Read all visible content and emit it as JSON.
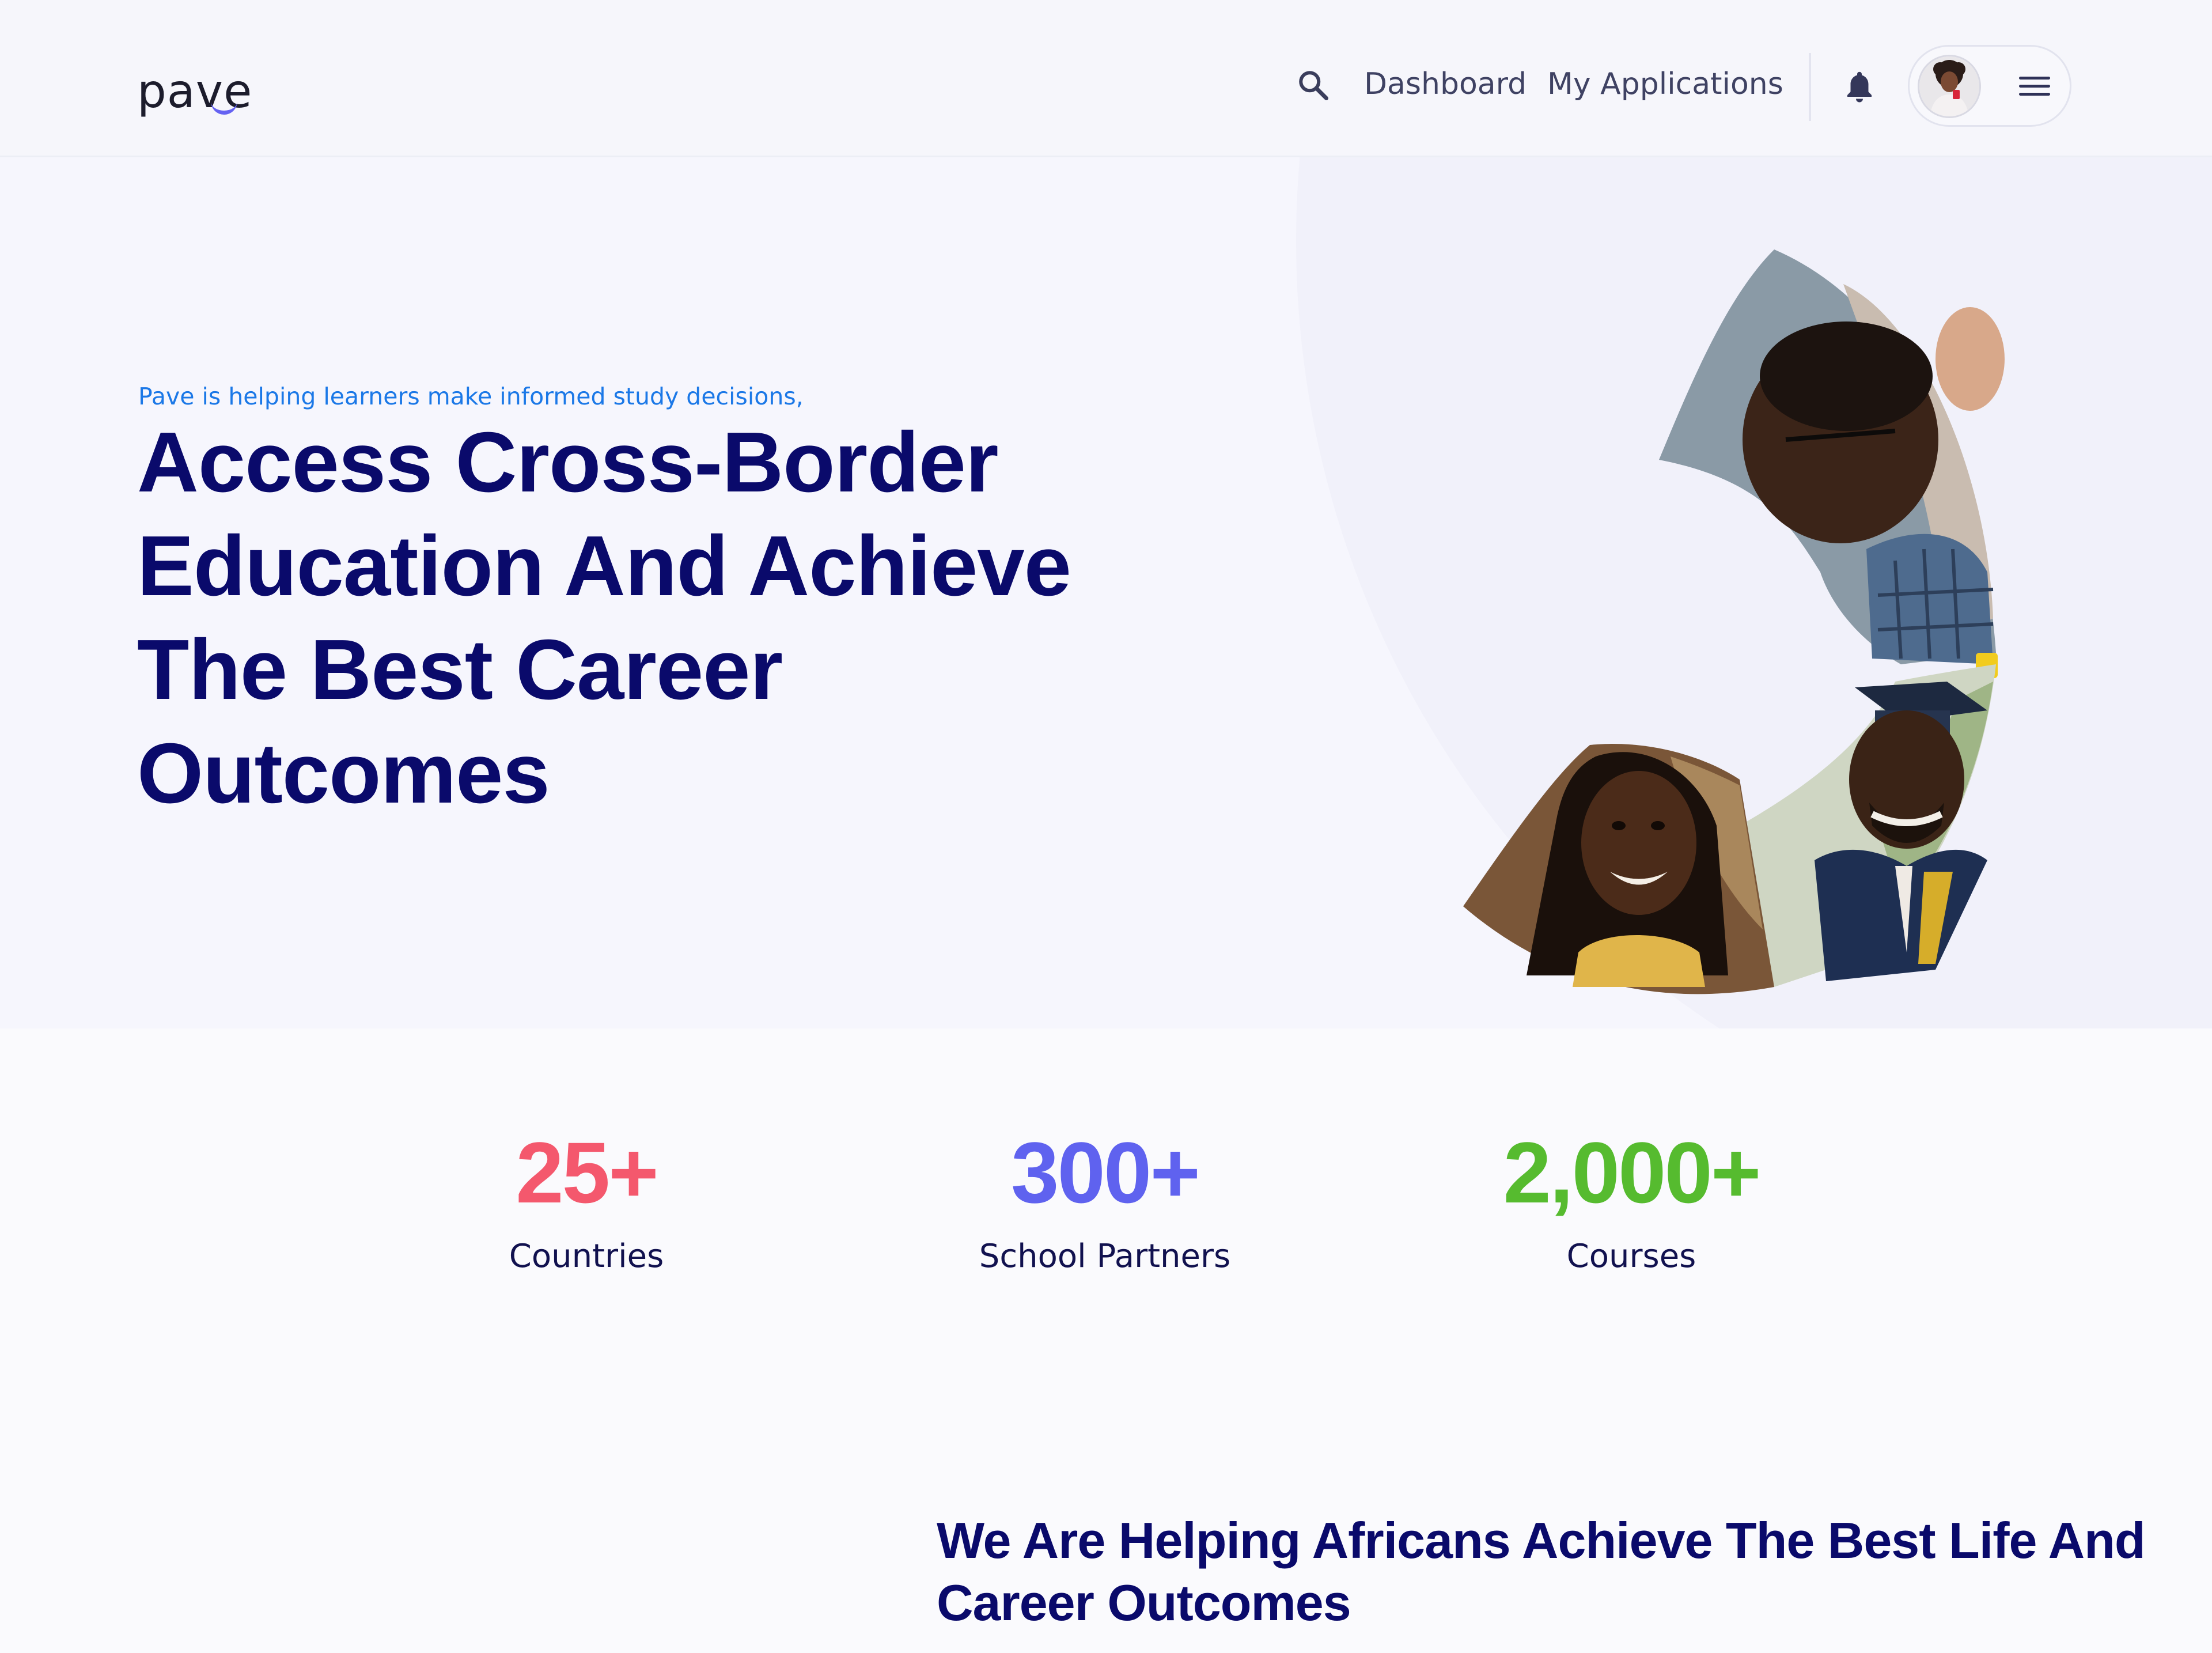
{
  "header": {
    "logo_text": "pave",
    "nav": {
      "dashboard": "Dashboard",
      "applications": "My Applications"
    },
    "icons": {
      "search": "search-icon",
      "notifications": "bell-icon",
      "menu": "hamburger-menu-icon"
    }
  },
  "hero": {
    "kicker": "Pave is helping learners make informed study decisions,",
    "title": "Access Cross-Border Education And Achieve The Best Career Outcomes"
  },
  "stats": [
    {
      "value": "25+",
      "label": "Countries",
      "color": "#f4586d"
    },
    {
      "value": "300+",
      "label": "School Partners",
      "color": "#5f62ef"
    },
    {
      "value": "2,000+",
      "label": "Courses",
      "color": "#56bb2f"
    }
  ],
  "section": {
    "title": "We Are Helping Africans Achieve The Best Life And Career Outcomes"
  },
  "colors": {
    "primary_navy": "#0a0a6b",
    "kicker_blue": "#1b78e7",
    "logo_accent": "#6562f2",
    "background": "#fafafd"
  }
}
